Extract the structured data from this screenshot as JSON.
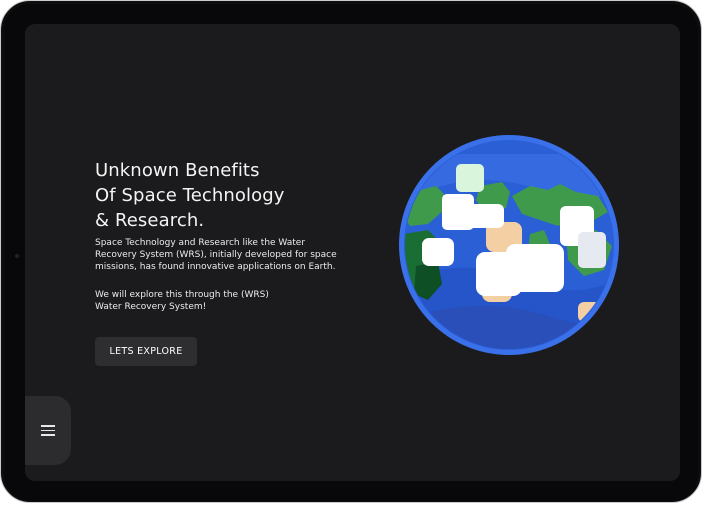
{
  "hero": {
    "title_lines": [
      "Unknown Benefits",
      "Of Space Technology",
      "& Research."
    ],
    "paragraph1_lines": [
      "Space Technology and Research like the Water",
      "Recovery System (WRS), initially developed for space",
      "missions, has found innovative applications on Earth."
    ],
    "paragraph2_lines": [
      "We will explore this through the (WRS)",
      "Water Recovery System!"
    ],
    "cta_label": "LETS EXPLORE"
  },
  "colors": {
    "screen_background": "#1b1b1d",
    "ocean": "#2a5fd6",
    "land": "#3f9a4c",
    "cloud": "#ffffff",
    "accent_sand": "#f4cfa3"
  },
  "icons": {
    "menu": "hamburger-icon",
    "illustration": "earth-globe"
  }
}
